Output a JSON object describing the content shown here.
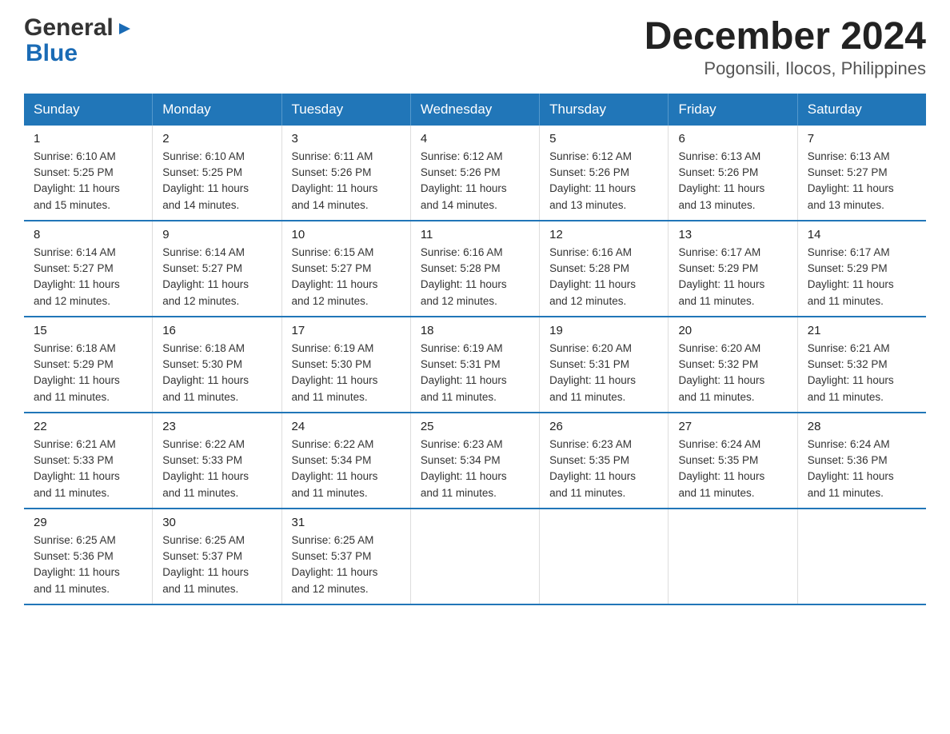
{
  "logo": {
    "general": "General",
    "blue": "Blue",
    "arrow": "▶"
  },
  "title": "December 2024",
  "subtitle": "Pogonsili, Ilocos, Philippines",
  "days": [
    "Sunday",
    "Monday",
    "Tuesday",
    "Wednesday",
    "Thursday",
    "Friday",
    "Saturday"
  ],
  "weeks": [
    [
      {
        "num": "1",
        "sunrise": "6:10 AM",
        "sunset": "5:25 PM",
        "daylight": "11 hours and 15 minutes."
      },
      {
        "num": "2",
        "sunrise": "6:10 AM",
        "sunset": "5:25 PM",
        "daylight": "11 hours and 14 minutes."
      },
      {
        "num": "3",
        "sunrise": "6:11 AM",
        "sunset": "5:26 PM",
        "daylight": "11 hours and 14 minutes."
      },
      {
        "num": "4",
        "sunrise": "6:12 AM",
        "sunset": "5:26 PM",
        "daylight": "11 hours and 14 minutes."
      },
      {
        "num": "5",
        "sunrise": "6:12 AM",
        "sunset": "5:26 PM",
        "daylight": "11 hours and 13 minutes."
      },
      {
        "num": "6",
        "sunrise": "6:13 AM",
        "sunset": "5:26 PM",
        "daylight": "11 hours and 13 minutes."
      },
      {
        "num": "7",
        "sunrise": "6:13 AM",
        "sunset": "5:27 PM",
        "daylight": "11 hours and 13 minutes."
      }
    ],
    [
      {
        "num": "8",
        "sunrise": "6:14 AM",
        "sunset": "5:27 PM",
        "daylight": "11 hours and 12 minutes."
      },
      {
        "num": "9",
        "sunrise": "6:14 AM",
        "sunset": "5:27 PM",
        "daylight": "11 hours and 12 minutes."
      },
      {
        "num": "10",
        "sunrise": "6:15 AM",
        "sunset": "5:27 PM",
        "daylight": "11 hours and 12 minutes."
      },
      {
        "num": "11",
        "sunrise": "6:16 AM",
        "sunset": "5:28 PM",
        "daylight": "11 hours and 12 minutes."
      },
      {
        "num": "12",
        "sunrise": "6:16 AM",
        "sunset": "5:28 PM",
        "daylight": "11 hours and 12 minutes."
      },
      {
        "num": "13",
        "sunrise": "6:17 AM",
        "sunset": "5:29 PM",
        "daylight": "11 hours and 11 minutes."
      },
      {
        "num": "14",
        "sunrise": "6:17 AM",
        "sunset": "5:29 PM",
        "daylight": "11 hours and 11 minutes."
      }
    ],
    [
      {
        "num": "15",
        "sunrise": "6:18 AM",
        "sunset": "5:29 PM",
        "daylight": "11 hours and 11 minutes."
      },
      {
        "num": "16",
        "sunrise": "6:18 AM",
        "sunset": "5:30 PM",
        "daylight": "11 hours and 11 minutes."
      },
      {
        "num": "17",
        "sunrise": "6:19 AM",
        "sunset": "5:30 PM",
        "daylight": "11 hours and 11 minutes."
      },
      {
        "num": "18",
        "sunrise": "6:19 AM",
        "sunset": "5:31 PM",
        "daylight": "11 hours and 11 minutes."
      },
      {
        "num": "19",
        "sunrise": "6:20 AM",
        "sunset": "5:31 PM",
        "daylight": "11 hours and 11 minutes."
      },
      {
        "num": "20",
        "sunrise": "6:20 AM",
        "sunset": "5:32 PM",
        "daylight": "11 hours and 11 minutes."
      },
      {
        "num": "21",
        "sunrise": "6:21 AM",
        "sunset": "5:32 PM",
        "daylight": "11 hours and 11 minutes."
      }
    ],
    [
      {
        "num": "22",
        "sunrise": "6:21 AM",
        "sunset": "5:33 PM",
        "daylight": "11 hours and 11 minutes."
      },
      {
        "num": "23",
        "sunrise": "6:22 AM",
        "sunset": "5:33 PM",
        "daylight": "11 hours and 11 minutes."
      },
      {
        "num": "24",
        "sunrise": "6:22 AM",
        "sunset": "5:34 PM",
        "daylight": "11 hours and 11 minutes."
      },
      {
        "num": "25",
        "sunrise": "6:23 AM",
        "sunset": "5:34 PM",
        "daylight": "11 hours and 11 minutes."
      },
      {
        "num": "26",
        "sunrise": "6:23 AM",
        "sunset": "5:35 PM",
        "daylight": "11 hours and 11 minutes."
      },
      {
        "num": "27",
        "sunrise": "6:24 AM",
        "sunset": "5:35 PM",
        "daylight": "11 hours and 11 minutes."
      },
      {
        "num": "28",
        "sunrise": "6:24 AM",
        "sunset": "5:36 PM",
        "daylight": "11 hours and 11 minutes."
      }
    ],
    [
      {
        "num": "29",
        "sunrise": "6:25 AM",
        "sunset": "5:36 PM",
        "daylight": "11 hours and 11 minutes."
      },
      {
        "num": "30",
        "sunrise": "6:25 AM",
        "sunset": "5:37 PM",
        "daylight": "11 hours and 11 minutes."
      },
      {
        "num": "31",
        "sunrise": "6:25 AM",
        "sunset": "5:37 PM",
        "daylight": "11 hours and 12 minutes."
      },
      null,
      null,
      null,
      null
    ]
  ]
}
